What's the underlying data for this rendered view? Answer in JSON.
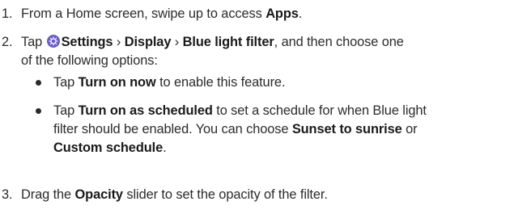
{
  "steps": [
    {
      "number": "1.",
      "text_before": "From a Home screen, swipe up to access ",
      "bold_apps": "Apps",
      "text_after": "."
    },
    {
      "number": "2.",
      "tap": "Tap ",
      "settings": "Settings",
      "sep1": " › ",
      "display": "Display",
      "sep2": " › ",
      "blue_light_filter": "Blue light filter",
      "line1_tail": ", and then choose one",
      "line2": "of the following options:",
      "bullets": [
        {
          "tap": "Tap ",
          "bold": "Turn on now",
          "tail": " to enable this feature."
        },
        {
          "tap": "Tap ",
          "bold": "Turn on as scheduled",
          "tail": " to set a schedule for when Blue light",
          "line2": "filter should be enabled. You can choose ",
          "opt1": "Sunset to sunrise",
          "or": " or",
          "opt2": "Custom schedule",
          "end": "."
        }
      ]
    },
    {
      "number": "3.",
      "drag": "Drag the ",
      "bold_opacity": "Opacity",
      "tail": " slider to set the opacity of the filter."
    }
  ],
  "icons": {
    "settings": "gear-icon",
    "settings_color": "#6a5acd"
  }
}
